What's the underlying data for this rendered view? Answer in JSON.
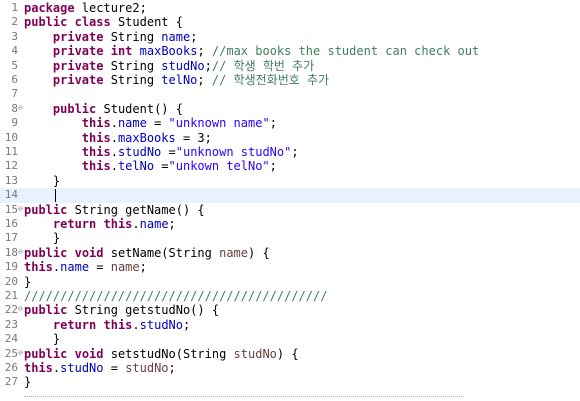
{
  "editor": {
    "lines": [
      {
        "n": "1",
        "fold": "",
        "seg": [
          [
            "kw",
            "package"
          ],
          [
            "t",
            " lecture2;"
          ]
        ]
      },
      {
        "n": "2",
        "fold": "",
        "seg": [
          [
            "kw",
            "public"
          ],
          [
            "t",
            " "
          ],
          [
            "kw",
            "class"
          ],
          [
            "t",
            " Student {"
          ]
        ]
      },
      {
        "n": "3",
        "fold": "",
        "seg": [
          [
            "t",
            "    "
          ],
          [
            "kw",
            "private"
          ],
          [
            "t",
            " String "
          ],
          [
            "fld",
            "name"
          ],
          [
            "t",
            ";"
          ]
        ]
      },
      {
        "n": "4",
        "fold": "",
        "seg": [
          [
            "t",
            "    "
          ],
          [
            "kw",
            "private"
          ],
          [
            "t",
            " "
          ],
          [
            "kw",
            "int"
          ],
          [
            "t",
            " "
          ],
          [
            "fld",
            "maxBooks"
          ],
          [
            "t",
            "; "
          ],
          [
            "cmt",
            "//max books the student can check out"
          ]
        ]
      },
      {
        "n": "5",
        "fold": "",
        "seg": [
          [
            "t",
            "    "
          ],
          [
            "kw",
            "private"
          ],
          [
            "t",
            " String "
          ],
          [
            "fld",
            "studNo"
          ],
          [
            "t",
            ";"
          ],
          [
            "cmt",
            "// 학생 학번 추가"
          ]
        ]
      },
      {
        "n": "6",
        "fold": "",
        "seg": [
          [
            "t",
            "    "
          ],
          [
            "kw",
            "private"
          ],
          [
            "t",
            " String "
          ],
          [
            "fld",
            "telNo"
          ],
          [
            "t",
            "; "
          ],
          [
            "cmt",
            "// 학생전화번호 추가"
          ]
        ]
      },
      {
        "n": "7",
        "fold": "",
        "seg": [
          [
            "t",
            ""
          ]
        ]
      },
      {
        "n": "8",
        "fold": "⊖",
        "seg": [
          [
            "t",
            "    "
          ],
          [
            "kw",
            "public"
          ],
          [
            "t",
            " Student() {"
          ]
        ]
      },
      {
        "n": "9",
        "fold": "",
        "seg": [
          [
            "t",
            "        "
          ],
          [
            "kw",
            "this"
          ],
          [
            "t",
            "."
          ],
          [
            "fld",
            "name"
          ],
          [
            "t",
            " = "
          ],
          [
            "str",
            "\"unknown name\""
          ],
          [
            "t",
            ";"
          ]
        ]
      },
      {
        "n": "10",
        "fold": "",
        "seg": [
          [
            "t",
            "        "
          ],
          [
            "kw",
            "this"
          ],
          [
            "t",
            "."
          ],
          [
            "fld",
            "maxBooks"
          ],
          [
            "t",
            " = 3;"
          ]
        ]
      },
      {
        "n": "11",
        "fold": "",
        "seg": [
          [
            "t",
            "        "
          ],
          [
            "kw",
            "this"
          ],
          [
            "t",
            "."
          ],
          [
            "fld",
            "studNo"
          ],
          [
            "t",
            " ="
          ],
          [
            "str",
            "\"unknown studNo\""
          ],
          [
            "t",
            ";"
          ]
        ]
      },
      {
        "n": "12",
        "fold": "",
        "seg": [
          [
            "t",
            "        "
          ],
          [
            "kw",
            "this"
          ],
          [
            "t",
            "."
          ],
          [
            "fld",
            "telNo"
          ],
          [
            "t",
            " ="
          ],
          [
            "str",
            "\"unkown telNo\""
          ],
          [
            "t",
            ";"
          ]
        ]
      },
      {
        "n": "13",
        "fold": "",
        "seg": [
          [
            "t",
            "    }"
          ]
        ]
      },
      {
        "n": "14",
        "fold": "",
        "seg": [
          [
            "t",
            ""
          ]
        ],
        "current": true
      },
      {
        "n": "15",
        "fold": "⊖",
        "seg": [
          [
            "kw",
            "public"
          ],
          [
            "t",
            " String getName() {"
          ]
        ]
      },
      {
        "n": "16",
        "fold": "",
        "seg": [
          [
            "t",
            "    "
          ],
          [
            "kw",
            "return"
          ],
          [
            "t",
            " "
          ],
          [
            "kw",
            "this"
          ],
          [
            "t",
            "."
          ],
          [
            "fld",
            "name"
          ],
          [
            "t",
            ";"
          ]
        ]
      },
      {
        "n": "17",
        "fold": "",
        "seg": [
          [
            "t",
            "    }"
          ]
        ]
      },
      {
        "n": "18",
        "fold": "⊖",
        "seg": [
          [
            "kw",
            "public"
          ],
          [
            "t",
            " "
          ],
          [
            "kw",
            "void"
          ],
          [
            "t",
            " setName(String "
          ],
          [
            "prm",
            "name"
          ],
          [
            "t",
            ") {"
          ]
        ]
      },
      {
        "n": "19",
        "fold": "",
        "seg": [
          [
            "kw",
            "this"
          ],
          [
            "t",
            "."
          ],
          [
            "fld",
            "name"
          ],
          [
            "t",
            " = "
          ],
          [
            "prm",
            "name"
          ],
          [
            "t",
            ";"
          ]
        ]
      },
      {
        "n": "20",
        "fold": "",
        "seg": [
          [
            "t",
            "}"
          ]
        ]
      },
      {
        "n": "21",
        "fold": "",
        "seg": [
          [
            "cmt",
            "//////////////////////////////////////////"
          ]
        ]
      },
      {
        "n": "22",
        "fold": "⊖",
        "seg": [
          [
            "kw",
            "public"
          ],
          [
            "t",
            " String getstudNo() {"
          ]
        ]
      },
      {
        "n": "23",
        "fold": "",
        "seg": [
          [
            "t",
            "    "
          ],
          [
            "kw",
            "return"
          ],
          [
            "t",
            " "
          ],
          [
            "kw",
            "this"
          ],
          [
            "t",
            "."
          ],
          [
            "fld",
            "studNo"
          ],
          [
            "t",
            ";"
          ]
        ]
      },
      {
        "n": "24",
        "fold": "",
        "seg": [
          [
            "t",
            "    }"
          ]
        ]
      },
      {
        "n": "25",
        "fold": "⊖",
        "seg": [
          [
            "kw",
            "public"
          ],
          [
            "t",
            " "
          ],
          [
            "kw",
            "void"
          ],
          [
            "t",
            " setstudNo(String "
          ],
          [
            "prm",
            "studNo"
          ],
          [
            "t",
            ") {"
          ]
        ]
      },
      {
        "n": "26",
        "fold": "",
        "seg": [
          [
            "kw",
            "this"
          ],
          [
            "t",
            "."
          ],
          [
            "fld",
            "studNo"
          ],
          [
            "t",
            " = "
          ],
          [
            "prm",
            "studNo"
          ],
          [
            "t",
            ";"
          ]
        ]
      },
      {
        "n": "27",
        "fold": "",
        "seg": [
          [
            "t",
            "}"
          ]
        ]
      }
    ]
  }
}
